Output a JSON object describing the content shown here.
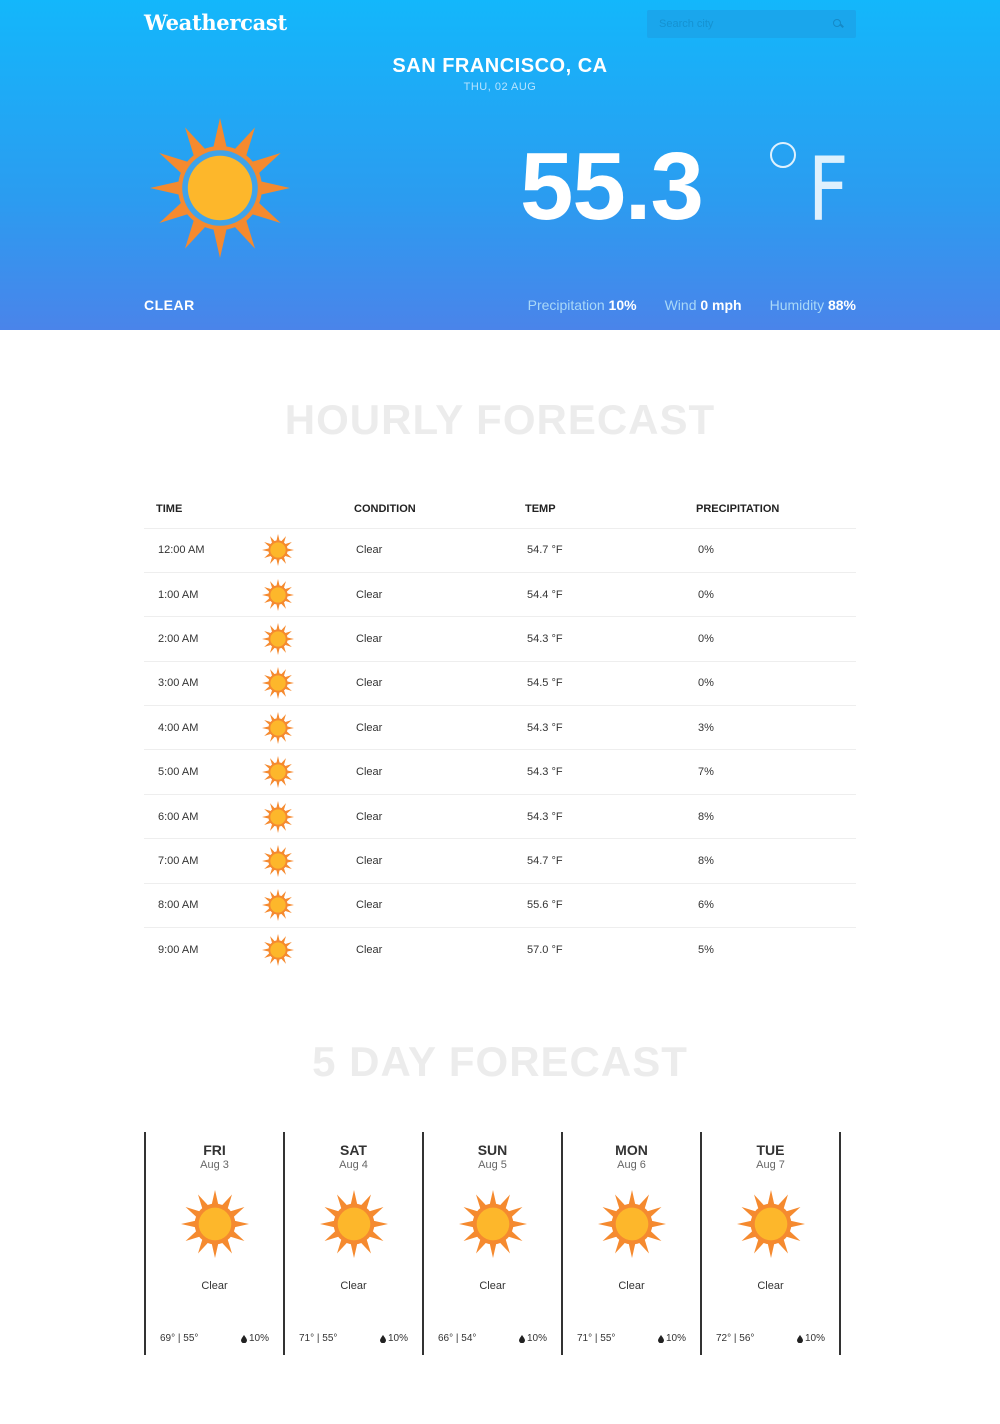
{
  "app": {
    "title": "Weathercast"
  },
  "search": {
    "placeholder": "Search city"
  },
  "location": {
    "city": "SAN FRANCISCO, CA",
    "date": "THU, 02 AUG"
  },
  "current": {
    "temperature": "55.3",
    "unit": "F",
    "condition": "CLEAR",
    "precipitation": {
      "label": "Precipitation",
      "value": "10%"
    },
    "wind": {
      "label": "Wind",
      "value": "0 mph"
    },
    "humidity": {
      "label": "Humidity",
      "value": "88%"
    }
  },
  "hourly": {
    "title": "HOURLY FORECAST",
    "headers": {
      "time": "TIME",
      "condition": "CONDITION",
      "temp": "TEMP",
      "precipitation": "PRECIPITATION"
    },
    "rows": [
      {
        "time": "12:00 AM",
        "condition": "Clear",
        "temp": "54.7 °F",
        "precip": "0%"
      },
      {
        "time": "1:00 AM",
        "condition": "Clear",
        "temp": "54.4 °F",
        "precip": "0%"
      },
      {
        "time": "2:00 AM",
        "condition": "Clear",
        "temp": "54.3 °F",
        "precip": "0%"
      },
      {
        "time": "3:00 AM",
        "condition": "Clear",
        "temp": "54.5 °F",
        "precip": "0%"
      },
      {
        "time": "4:00 AM",
        "condition": "Clear",
        "temp": "54.3 °F",
        "precip": "3%"
      },
      {
        "time": "5:00 AM",
        "condition": "Clear",
        "temp": "54.3 °F",
        "precip": "7%"
      },
      {
        "time": "6:00 AM",
        "condition": "Clear",
        "temp": "54.3 °F",
        "precip": "8%"
      },
      {
        "time": "7:00 AM",
        "condition": "Clear",
        "temp": "54.7 °F",
        "precip": "8%"
      },
      {
        "time": "8:00 AM",
        "condition": "Clear",
        "temp": "55.6 °F",
        "precip": "6%"
      },
      {
        "time": "9:00 AM",
        "condition": "Clear",
        "temp": "57.0 °F",
        "precip": "5%"
      }
    ]
  },
  "daily": {
    "title": "5 DAY FORECAST",
    "days": [
      {
        "day": "FRI",
        "date": "Aug 3",
        "condition": "Clear",
        "range": "69° | 55°",
        "precip": "10%"
      },
      {
        "day": "SAT",
        "date": "Aug 4",
        "condition": "Clear",
        "range": "71° | 55°",
        "precip": "10%"
      },
      {
        "day": "SUN",
        "date": "Aug 5",
        "condition": "Clear",
        "range": "66° | 54°",
        "precip": "10%"
      },
      {
        "day": "MON",
        "date": "Aug 6",
        "condition": "Clear",
        "range": "71° | 55°",
        "precip": "10%"
      },
      {
        "day": "TUE",
        "date": "Aug 7",
        "condition": "Clear",
        "range": "72° | 56°",
        "precip": "10%"
      }
    ]
  },
  "icons": {
    "weather": "sun-icon",
    "search": "search-icon",
    "precip": "raindrop-icon"
  },
  "colors": {
    "sun_orange": "#f58a2f",
    "sun_yellow": "#fdb72b",
    "hero_top": "#13b7fb",
    "hero_bottom": "#4a84ea"
  }
}
